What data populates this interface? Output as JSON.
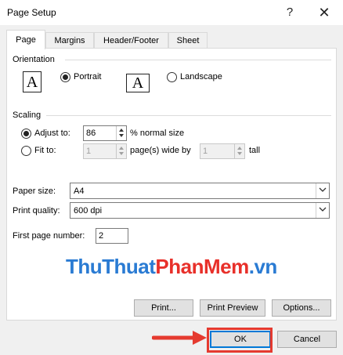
{
  "window": {
    "title": "Page Setup"
  },
  "tabs": [
    {
      "label": "Page",
      "active": true
    },
    {
      "label": "Margins",
      "active": false
    },
    {
      "label": "Header/Footer",
      "active": false
    },
    {
      "label": "Sheet",
      "active": false
    }
  ],
  "orientation": {
    "title": "Orientation",
    "icon_letter": "A",
    "portrait_label": "Portrait",
    "landscape_label": "Landscape",
    "selected": "portrait"
  },
  "scaling": {
    "title": "Scaling",
    "adjust_label": "Adjust to:",
    "adjust_value": "86",
    "adjust_suffix": "% normal size",
    "fit_label": "Fit to:",
    "fit_wide_value": "1",
    "fit_wide_suffix": "page(s) wide by",
    "fit_tall_value": "1",
    "fit_tall_suffix": "tall",
    "selected": "adjust"
  },
  "paper": {
    "size_label": "Paper size:",
    "size_value": "A4",
    "quality_label": "Print quality:",
    "quality_value": "600 dpi",
    "first_page_label": "First page number:",
    "first_page_value": "2"
  },
  "watermark": {
    "part1": "ThuThuat",
    "part2": "PhanMem",
    "part3": ".vn"
  },
  "buttons": {
    "print": "Print...",
    "print_preview": "Print Preview",
    "options": "Options...",
    "ok": "OK",
    "cancel": "Cancel"
  },
  "colors": {
    "accent": "#0078d7",
    "annotation": "#e53a2f"
  }
}
